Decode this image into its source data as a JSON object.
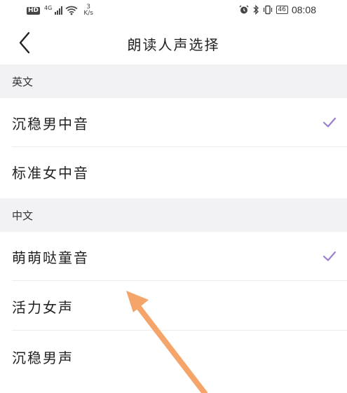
{
  "status_bar": {
    "hd": "HD",
    "network": "4G",
    "speed_value": "3",
    "speed_unit": "K/s",
    "battery": "46",
    "time": "08:08"
  },
  "header": {
    "title": "朗读人声选择"
  },
  "sections": [
    {
      "label": "英文",
      "options": [
        {
          "label": "沉稳男中音",
          "selected": true
        },
        {
          "label": "标准女中音",
          "selected": false
        }
      ]
    },
    {
      "label": "中文",
      "options": [
        {
          "label": "萌萌哒童音",
          "selected": true
        },
        {
          "label": "活力女声",
          "selected": false
        },
        {
          "label": "沉稳男声",
          "selected": false
        }
      ]
    }
  ],
  "colors": {
    "accent": "#9b7fcf",
    "section_bg": "#f2f2f5",
    "annotation_arrow": "#f5a46a"
  }
}
